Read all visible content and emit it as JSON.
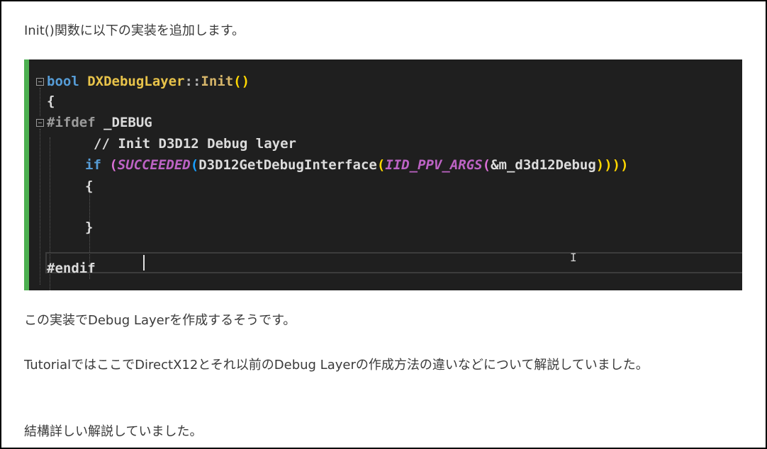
{
  "paragraphs": {
    "intro": "Init()関数に以下の実装を追加します。",
    "after_code": "この実装でDebug Layerを作成するそうです。",
    "tutorial": "TutorialではここでDirectX12とそれ以前のDebug Layerの作成方法の違いなどについて解説していました。",
    "closing": "結構詳しい解説していました。"
  },
  "code": {
    "l1_kw": "bool",
    "l1_type": "DXDebugLayer",
    "l1_sep": "::",
    "l1_fn": "Init",
    "l1_paren": "()",
    "l2": "{",
    "l3_pp": "#ifdef",
    "l3_macro": "_DEBUG",
    "l4_comment": "// Init D3D12 Debug layer",
    "l5_if": "if",
    "l5_open": "(",
    "l5_succ": "SUCCEEDED",
    "l5_open2": "(",
    "l5_fn": "D3D12GetDebugInterface",
    "l5_open3": "(",
    "l5_iid": "IID_PPV_ARGS",
    "l5_open4": "(",
    "l5_arg": "&m_d3d12Debug",
    "l5_close": "))))",
    "l6": "{",
    "l8": "}",
    "l10_pp": "#endif"
  },
  "colors": {
    "code_background": "#1f1f1f",
    "gutter_accent": "#4caf50",
    "keyword": "#569cd6",
    "comment": "#57a64a",
    "macro": "#bd63c5"
  }
}
